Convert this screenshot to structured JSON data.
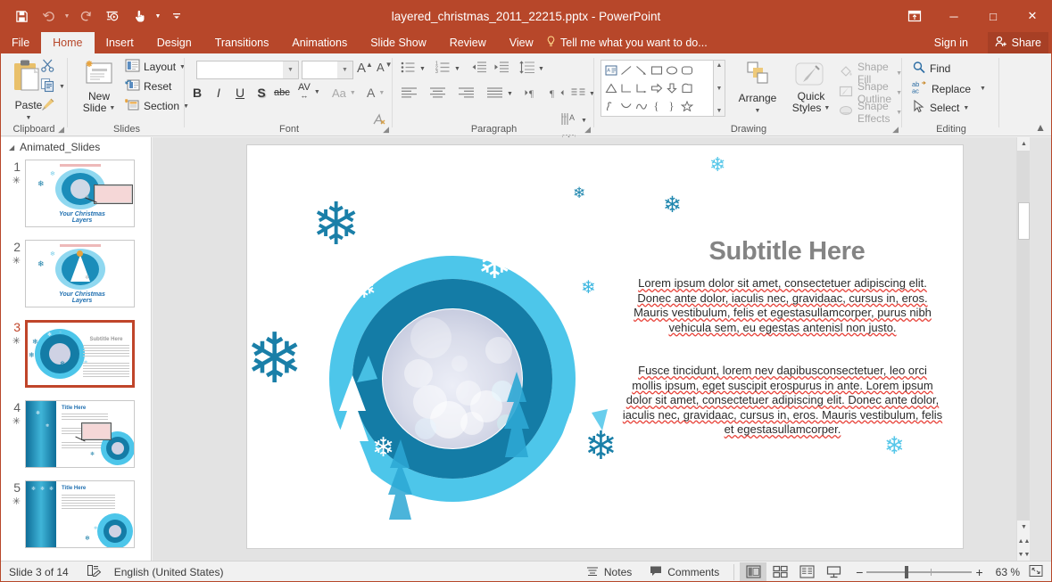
{
  "window": {
    "title": "layered_christmas_2011_22215.pptx - PowerPoint",
    "minimize": "─",
    "maximize": "□",
    "close": "✕",
    "ribbon_display_options": "ribbon-display-icon"
  },
  "qat": {
    "items": [
      {
        "name": "save-icon",
        "glyph": "💾"
      },
      {
        "name": "undo-icon",
        "glyph": "↶"
      },
      {
        "name": "redo-icon",
        "glyph": "↻"
      },
      {
        "name": "start-from-beginning-icon",
        "glyph": "⬒"
      },
      {
        "name": "touch-mode-icon",
        "glyph": "☝"
      },
      {
        "name": "customize-qat-icon",
        "glyph": "≃"
      }
    ]
  },
  "tabs": [
    {
      "label": "File",
      "active": false
    },
    {
      "label": "Home",
      "active": true
    },
    {
      "label": "Insert",
      "active": false
    },
    {
      "label": "Design",
      "active": false
    },
    {
      "label": "Transitions",
      "active": false
    },
    {
      "label": "Animations",
      "active": false
    },
    {
      "label": "Slide Show",
      "active": false
    },
    {
      "label": "Review",
      "active": false
    },
    {
      "label": "View",
      "active": false
    }
  ],
  "tellme": "Tell me what you want to do...",
  "signin": "Sign in",
  "share": "Share",
  "ribbon": {
    "clipboard": {
      "label": "Clipboard",
      "paste": "Paste",
      "cut_icon": "scissors-icon",
      "copy_icon": "copy-icon",
      "format_painter_icon": "format-painter-icon"
    },
    "slides": {
      "label": "Slides",
      "new_slide": "New\nSlide",
      "new_slide_line1": "New",
      "new_slide_line2": "Slide",
      "layout": "Layout",
      "reset": "Reset",
      "section": "Section"
    },
    "font": {
      "label": "Font",
      "font_name_value": "",
      "font_size_value": "",
      "grow_font": "A",
      "shrink_font": "A",
      "clear_formatting_icon": "clear-formatting-icon",
      "bold": "B",
      "italic": "I",
      "underline": "U",
      "shadow": "S",
      "strikethrough": "abc",
      "character_spacing": "AV",
      "change_case": "Aa",
      "font_color": "A"
    },
    "paragraph": {
      "label": "Paragraph",
      "bullets_icon": "bullets-icon",
      "numbering_icon": "numbering-icon",
      "decrease_indent_icon": "decrease-indent-icon",
      "increase_indent_icon": "increase-indent-icon",
      "line_spacing_icon": "line-spacing-icon",
      "text_direction_icon": "text-direction-icon",
      "align_text_icon": "align-text-icon",
      "convert_smartart_icon": "convert-to-smartart-icon",
      "align_left_icon": "align-left-icon",
      "align_center_icon": "align-center-icon",
      "align_right_icon": "align-right-icon",
      "justify_icon": "justify-icon",
      "columns_icon": "columns-icon",
      "ltr_icon": "left-to-right-icon",
      "rtl_icon": "right-to-left-icon"
    },
    "drawing": {
      "label": "Drawing",
      "arrange": "Arrange",
      "quick_styles_line1": "Quick",
      "quick_styles_line2": "Styles",
      "shape_fill": "Shape Fill",
      "shape_outline": "Shape Outline",
      "shape_effects": "Shape Effects",
      "shapes": [
        "textbox-shape",
        "line-shape",
        "arrow-shape",
        "rectangle-shape",
        "oval-shape",
        "rounded-rectangle-shape",
        "scroll-shape",
        "triangle-shape",
        "elbow-connector-shape",
        "elbow-arrow-shape",
        "right-arrow-shape",
        "down-arrow-shape",
        "pentagon-shape",
        "star-shape",
        "freeform-shape",
        "curve-shape",
        "arc-shape",
        "left-brace-shape",
        "right-brace-shape",
        "star5-shape",
        "more-shape"
      ]
    },
    "editing": {
      "label": "Editing",
      "find": "Find",
      "replace": "Replace",
      "select": "Select",
      "collapse_ribbon_icon": "collapse-ribbon-icon"
    }
  },
  "thumbnails": {
    "section_name": "Animated_Slides",
    "slides": [
      {
        "number": "1",
        "star": "✳",
        "selected": false,
        "kind": "title",
        "caption": "Your Christmas Layers"
      },
      {
        "number": "2",
        "star": "✳",
        "selected": false,
        "kind": "title2",
        "caption": "Your Christmas Layers"
      },
      {
        "number": "3",
        "star": "✳",
        "selected": true,
        "kind": "subtitle",
        "caption": "Subtitle Here"
      },
      {
        "number": "4",
        "star": "✳",
        "selected": false,
        "kind": "points",
        "caption": "Title Here"
      },
      {
        "number": "5",
        "star": "✳",
        "selected": false,
        "kind": "titlebody",
        "caption": "Title Here"
      }
    ]
  },
  "slide": {
    "subtitle": "Subtitle Here",
    "paragraph1": "Lorem ipsum dolor sit amet, consectetuer adipiscing elit. Donec ante dolor, iaculis nec, gravidaac, cursus in, eros. Mauris vestibulum, felis et egestasullamcorper, purus nibh vehicula sem, eu egestas antenisl non justo.",
    "paragraph2": "Fusce tincidunt, lorem nev dapibusconsectetuer, leo orci mollis ipsum, eget suscipit erospurus in ante. Lorem ipsum dolor sit amet, consectetuer adipiscing elit. Donec ante dolor, iaculis nec, gravidaac, cursus in, eros. Mauris vestibulum, felis et egestasullamcorper.",
    "colors": {
      "light_blue": "#4DC6EA",
      "mid_blue": "#1B8DBA",
      "dark_blue": "#147CA6",
      "snowflake_dark": "#1A7FA8",
      "snowflake_light": "#52C5E8",
      "subtitle_grey": "#848484"
    }
  },
  "status": {
    "slide_position": "Slide 3 of 14",
    "language_icon": "spellcheck-icon",
    "language": "English (United States)",
    "notes": "Notes",
    "comments": "Comments",
    "views": [
      {
        "name": "normal-view",
        "glyph": "▤",
        "active": true
      },
      {
        "name": "slide-sorter-view",
        "glyph": "☷",
        "active": false
      },
      {
        "name": "reading-view",
        "glyph": "▥",
        "active": false
      },
      {
        "name": "slide-show-view",
        "glyph": "▭",
        "active": false
      }
    ],
    "zoom_out": "−",
    "zoom_in": "+",
    "zoom_level": "63 %",
    "fit_slide_icon": "fit-to-window-icon"
  }
}
